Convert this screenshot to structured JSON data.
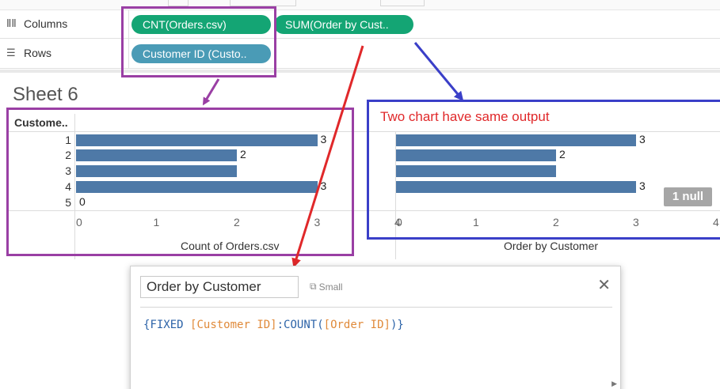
{
  "shelves": {
    "columns_label": "Columns",
    "rows_label": "Rows",
    "columns_pills": [
      "CNT(Orders.csv)",
      "SUM(Order by Cust.."
    ],
    "rows_pills": [
      "Customer ID (Custo.."
    ]
  },
  "sheet": {
    "title": "Sheet 6",
    "row_header": "Custome..",
    "customers": [
      "1",
      "2",
      "3",
      "4",
      "5"
    ],
    "null_badge": "1 null"
  },
  "chart_data": [
    {
      "type": "bar",
      "orientation": "horizontal",
      "categories": [
        "1",
        "2",
        "3",
        "4",
        "5"
      ],
      "values": [
        3,
        2,
        2,
        3,
        0
      ],
      "data_labels": [
        "3",
        "2",
        "",
        "3",
        "0"
      ],
      "xlabel": "Count of Orders.csv",
      "xlim": [
        0,
        4
      ],
      "xticks": [
        "0",
        "1",
        "2",
        "3",
        "4"
      ],
      "bar_color": "#4e79a7"
    },
    {
      "type": "bar",
      "orientation": "horizontal",
      "categories": [
        "1",
        "2",
        "3",
        "4"
      ],
      "values": [
        3,
        2,
        2,
        3
      ],
      "data_labels": [
        "3",
        "2",
        "",
        "3"
      ],
      "xlabel": "Order by Customer",
      "xlim": [
        0,
        4
      ],
      "xticks": [
        "0",
        "1",
        "2",
        "3",
        "4"
      ],
      "bar_color": "#4e79a7"
    }
  ],
  "annotation": {
    "text": "Two chart have same output",
    "purple": "#9a3fa4",
    "blue": "#3a3fc8",
    "red": "#e0282a"
  },
  "dialog": {
    "calc_name": "Order by Customer",
    "size_label": "Small",
    "close_icon": "close-icon",
    "formula": {
      "open": "{",
      "keyword": "FIXED",
      "field1": "[Customer ID]",
      "colon": ":",
      "fn": "COUNT",
      "paren_open": "(",
      "field2": "[Order ID]",
      "paren_close": ")",
      "close": "}"
    }
  }
}
